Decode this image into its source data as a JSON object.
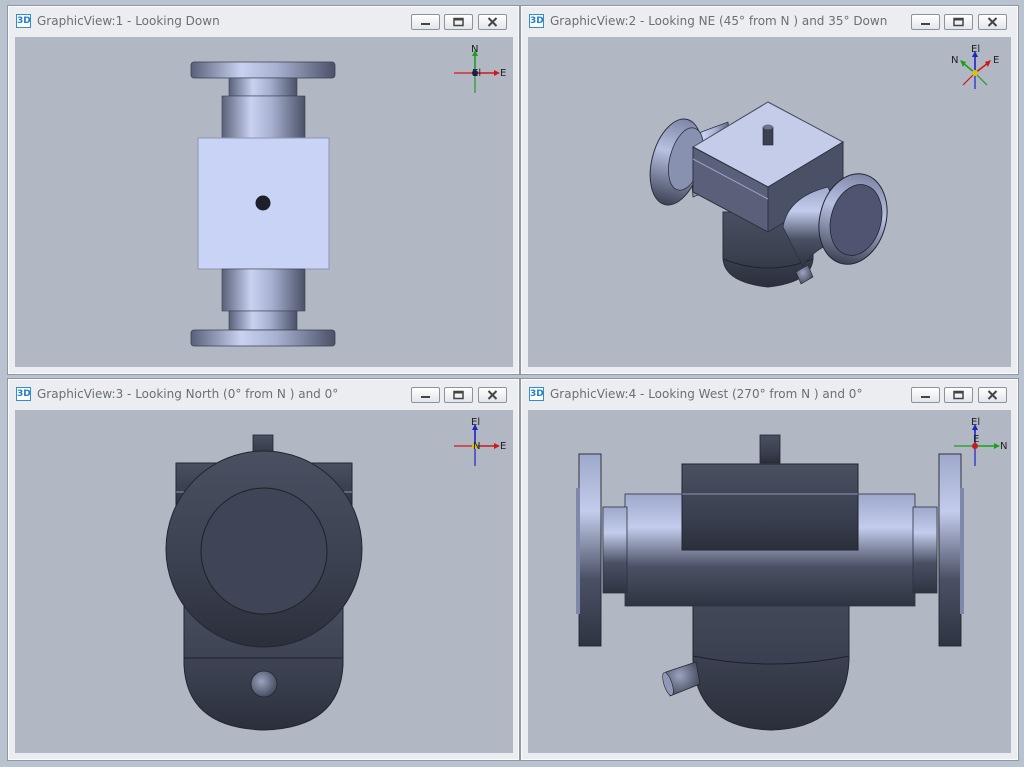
{
  "views": [
    {
      "badge": "3D",
      "title": "GraphicView:1 - Looking Down",
      "axes": {
        "up": "N",
        "right": "E",
        "center": "El"
      }
    },
    {
      "badge": "3D",
      "title": "GraphicView:2 - Looking NE (45° from N ) and 35° Down",
      "axes": {
        "up": "El",
        "left": "N",
        "right": "E"
      }
    },
    {
      "badge": "3D",
      "title": "GraphicView:3 - Looking North (0° from N ) and 0°",
      "axes": {
        "up": "El",
        "right": "E",
        "center": "N"
      }
    },
    {
      "badge": "3D",
      "title": "GraphicView:4 - Looking West (270° from N ) and 0°",
      "axes": {
        "up": "El",
        "right": "N",
        "center": "E"
      }
    }
  ],
  "colors": {
    "viewport": "#b1b7c3",
    "bodyDark": "#3f4556",
    "bodyLight": "#c7d0ef"
  }
}
